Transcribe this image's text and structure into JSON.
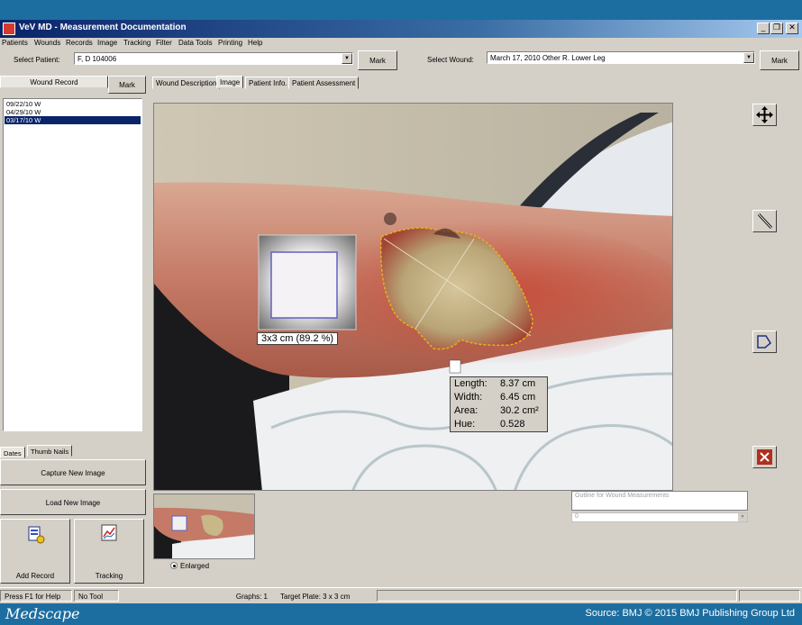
{
  "window": {
    "title": "VeV MD - Measurement Documentation",
    "minimize": "_",
    "restore": "❐",
    "close": "✕"
  },
  "menu": [
    "Patients",
    "Wounds",
    "Records",
    "Image",
    "Tracking",
    "Filter",
    "Data Tools",
    "Printing",
    "Help"
  ],
  "patient": {
    "label": "Select Patient:",
    "value": "F, D    104006",
    "mark": "Mark"
  },
  "wound": {
    "label": "Select Wound:",
    "value": "March 17, 2010   Other R. Lower Leg",
    "mark": "Mark"
  },
  "left_panel": {
    "tab_records": "Wound Record",
    "mark": "Mark",
    "records": [
      "09/22/10 W",
      "04/29/10 W",
      "03/17/10 W"
    ],
    "selected_index": 2,
    "tab_dates": "Dates",
    "tab_thumbs": "Thumb Nails",
    "capture": "Capture New Image",
    "load": "Load New Image",
    "add_record": "Add Record",
    "tracking": "Tracking"
  },
  "tabs": [
    "Wound Description",
    "Image",
    "Patient Info.",
    "Patient Assessment"
  ],
  "active_tab": "Image",
  "measurement": {
    "target_label": "3x3 cm  (89.2 %)",
    "rows": [
      {
        "key": "Length:",
        "value": "8.37 cm"
      },
      {
        "key": "Width:",
        "value": "6.45 cm"
      },
      {
        "key": "Area:",
        "value": "30.2 cm²"
      },
      {
        "key": "Hue:",
        "value": "0.528"
      }
    ]
  },
  "tools": {
    "pan": "move-arrows-icon",
    "ruler": "ruler-icon",
    "trace": "trace-icon",
    "delete": "delete-trace-icon"
  },
  "thumbnail": {
    "radio_label": "Enlarged"
  },
  "outline": {
    "placeholder": "Outline for Wound Measurements",
    "combo_value": "0"
  },
  "status": {
    "help": "Press F1 for Help",
    "tool": "No Tool",
    "graphs": "Graphs: 1",
    "plate": "Target Plate: 3 x 3 cm"
  },
  "footer": {
    "logo": "Medscape",
    "source": "Source: BMJ © 2015 BMJ Publishing Group Ltd"
  },
  "colors": {
    "window_bg": "#d4d0c8",
    "title_start": "#0a246a",
    "footer_bg": "#1d6ea0",
    "trace": "#e8b21a",
    "selection": "#0a246a"
  }
}
